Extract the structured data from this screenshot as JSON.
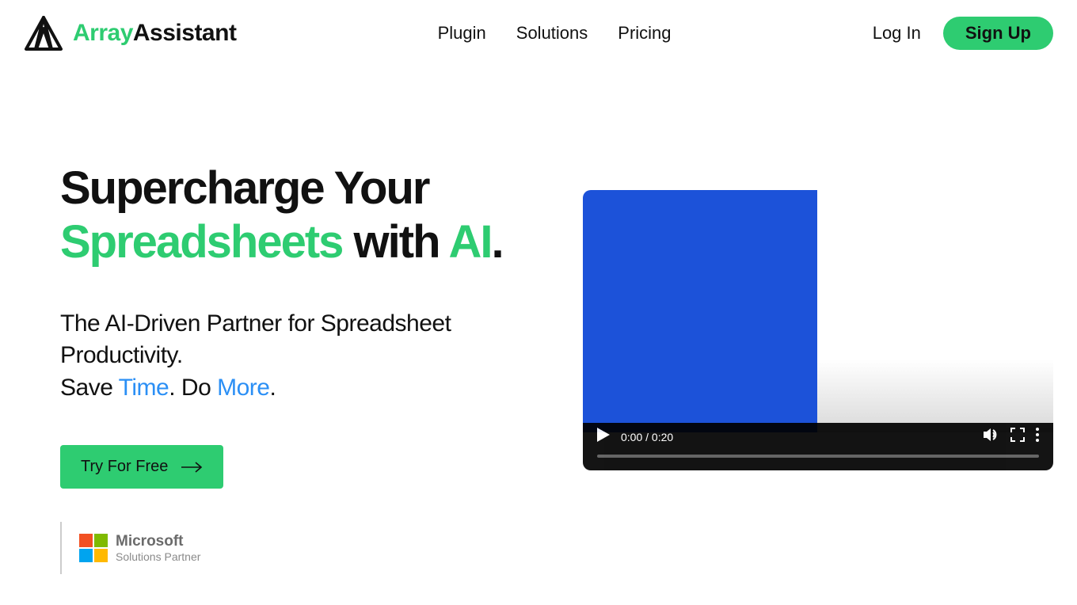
{
  "brand": {
    "name_part1": "Array",
    "name_part2": "Assistant"
  },
  "nav": {
    "plugin": "Plugin",
    "solutions": "Solutions",
    "pricing": "Pricing"
  },
  "auth": {
    "login": "Log In",
    "signup": "Sign Up"
  },
  "hero": {
    "headline_1": "Supercharge Your ",
    "headline_accent": "Spreadsheets",
    "headline_2": " with ",
    "headline_ai": "AI",
    "headline_dot": ".",
    "sub_1": "The AI-Driven Partner for Spreadsheet Productivity.",
    "sub_2a": "Save ",
    "sub_time": "Time",
    "sub_2b": ". Do ",
    "sub_more": "More",
    "sub_2c": ".",
    "cta": "Try For Free"
  },
  "partner": {
    "line1": "Microsoft",
    "line2": "Solutions Partner"
  },
  "video": {
    "time": "0:00 / 0:20"
  },
  "colors": {
    "green": "#2ecc71",
    "blue": "#2b8ff5",
    "video_blue": "#1c52d9"
  }
}
